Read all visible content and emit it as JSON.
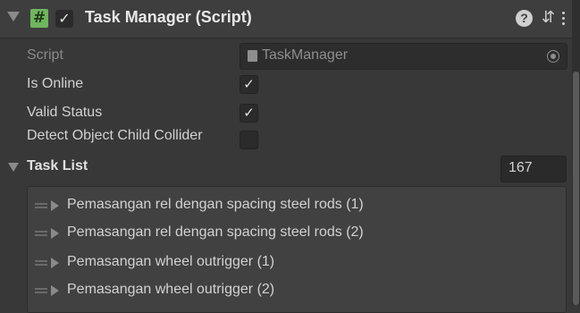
{
  "header": {
    "title": "Task Manager (Script)",
    "enabled": true,
    "icons": [
      "fold-arrow-icon",
      "script-icon",
      "help-icon",
      "presets-icon",
      "menu-icon"
    ],
    "script_icon_glyph": "#",
    "check_glyph": "✓",
    "help_glyph": "?",
    "presets_glyph": "⇵"
  },
  "fields": {
    "script": {
      "label": "Script",
      "value": "TaskManager"
    },
    "is_online": {
      "label": "Is Online",
      "checked": true
    },
    "valid_status": {
      "label": "Valid Status",
      "checked": true
    },
    "detect_child": {
      "label": "Detect Object Child Collider",
      "checked": false
    }
  },
  "task_list": {
    "label": "Task List",
    "count": "167",
    "items": [
      "Pemasangan rel dengan spacing steel rods (1)",
      "Pemasangan rel dengan spacing steel rods (2)",
      "Pemasangan wheel outrigger (1)",
      "Pemasangan wheel outrigger (2)"
    ]
  },
  "colors": {
    "background": "#383838",
    "script_icon": "#6fb55d",
    "text": "#d2d2d2"
  }
}
